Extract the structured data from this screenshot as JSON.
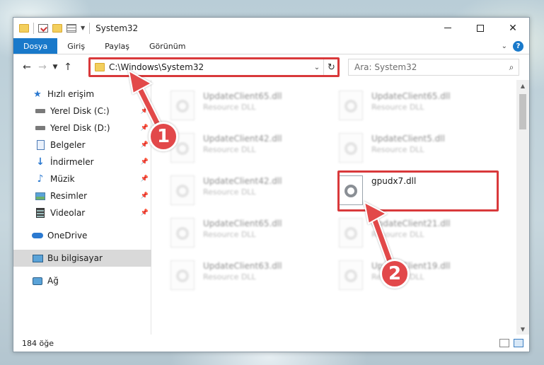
{
  "window": {
    "title": "System32"
  },
  "ribbon": {
    "tabs": [
      "Dosya",
      "Giriş",
      "Paylaş",
      "Görünüm"
    ],
    "help": "?"
  },
  "address": {
    "path": "C:\\Windows\\System32",
    "search_placeholder": "Ara: System32"
  },
  "nav": {
    "quick_access": "Hızlı erişim",
    "items": [
      {
        "label": "Yerel Disk (C:)",
        "icon": "drive-icon"
      },
      {
        "label": "Yerel Disk (D:)",
        "icon": "drive-icon"
      },
      {
        "label": "Belgeler",
        "icon": "documents-icon"
      },
      {
        "label": "İndirmeler",
        "icon": "downloads-icon"
      },
      {
        "label": "Müzik",
        "icon": "music-icon"
      },
      {
        "label": "Resimler",
        "icon": "pictures-icon"
      },
      {
        "label": "Videolar",
        "icon": "videos-icon"
      }
    ],
    "onedrive": "OneDrive",
    "this_pc": "Bu bilgisayar",
    "network": "Ağ"
  },
  "files": [
    {
      "name": "UpdateClient65.dll",
      "type": "Resource DLL"
    },
    {
      "name": "UpdateClient65.dll",
      "type": "Resource DLL"
    },
    {
      "name": "UpdateClient42.dll",
      "type": "Resource DLL"
    },
    {
      "name": "UpdateClient5.dll",
      "type": "Resource DLL"
    },
    {
      "name": "UpdateClient42.dll",
      "type": "Resource DLL"
    },
    {
      "name": "gpudx7.dll",
      "type": ""
    },
    {
      "name": "UpdateClient65.dll",
      "type": "Resource DLL"
    },
    {
      "name": "UpdateClient21.dll",
      "type": "Resource DLL"
    },
    {
      "name": "UpdateClient63.dll",
      "type": "Resource DLL"
    },
    {
      "name": "UpdateClient19.dll",
      "type": "Resource DLL"
    }
  ],
  "status": {
    "count": "184 öğe"
  },
  "annotations": {
    "step1": "1",
    "step2": "2",
    "color": "#e2484a"
  }
}
